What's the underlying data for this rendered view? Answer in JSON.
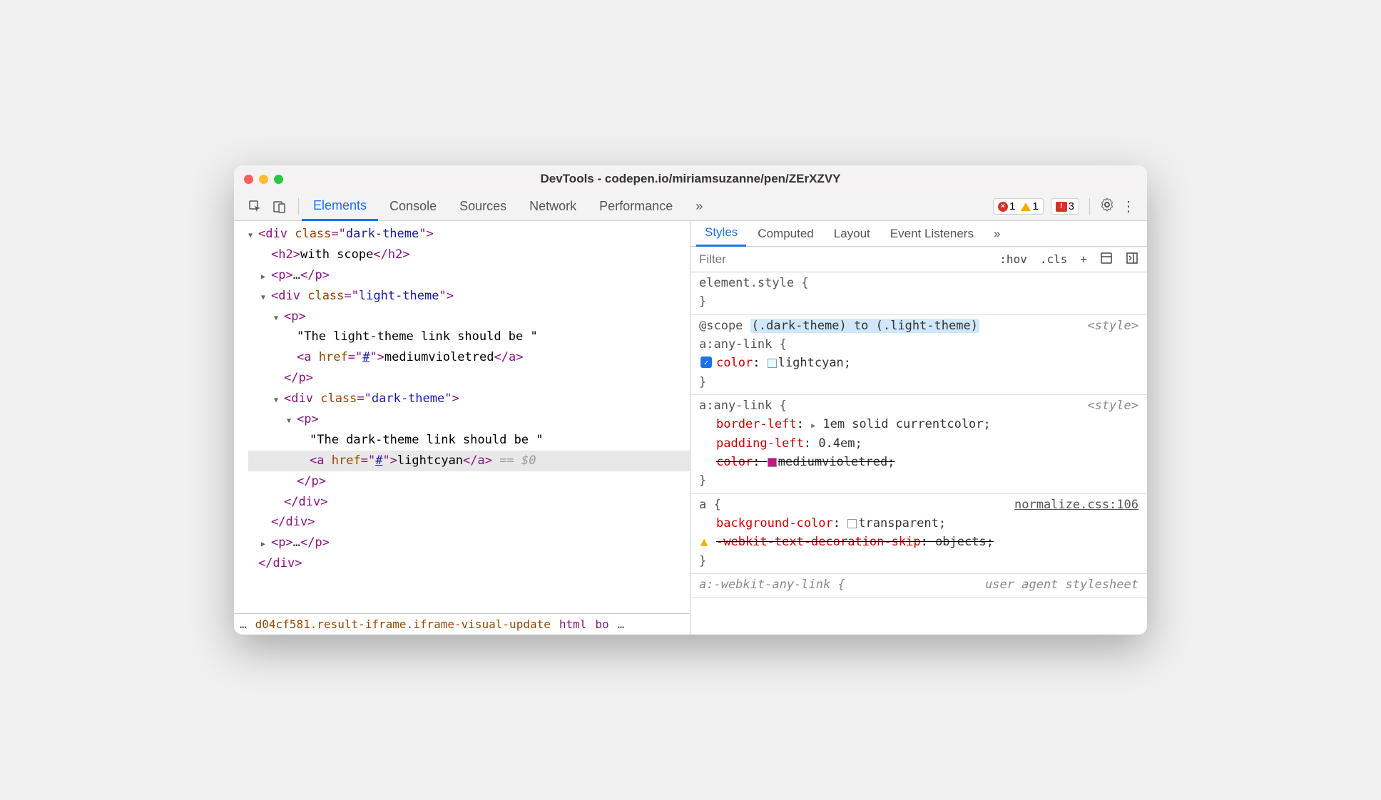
{
  "title": "DevTools - codepen.io/miriamsuzanne/pen/ZErXZVY",
  "tabs": [
    "Elements",
    "Console",
    "Sources",
    "Network",
    "Performance"
  ],
  "tabs_more": "»",
  "badges": {
    "errors": "1",
    "warnings": "1",
    "messages": "3"
  },
  "dom": {
    "l1": {
      "tag": "div",
      "attr": "class",
      "val": "dark-theme"
    },
    "l2": {
      "tag": "h2",
      "text": "with scope"
    },
    "l3": {
      "tag": "p",
      "ell": "…"
    },
    "l4": {
      "tag": "div",
      "attr": "class",
      "val": "light-theme"
    },
    "l5": {
      "tag": "p"
    },
    "l6": {
      "text": "\"The light-theme link should be \""
    },
    "l7": {
      "tag": "a",
      "attr": "href",
      "val": "#",
      "text": "mediumvioletred"
    },
    "l8": {
      "close": "p"
    },
    "l9": {
      "tag": "div",
      "attr": "class",
      "val": "dark-theme"
    },
    "l10": {
      "tag": "p"
    },
    "l11": {
      "text": "\"The dark-theme link should be \""
    },
    "l12": {
      "tag": "a",
      "attr": "href",
      "val": "#",
      "text": "lightcyan",
      "marker": "== $0"
    },
    "l13": {
      "close": "p"
    },
    "l14": {
      "close": "div"
    },
    "l15": {
      "close": "div"
    },
    "l16": {
      "tag": "p",
      "ell": "…"
    },
    "l17": {
      "close": "div"
    }
  },
  "breadcrumbs": {
    "dots": "…",
    "i1": "d04cf581.result-iframe.iframe-visual-update",
    "i2": "html",
    "i3": "bo",
    "trail": "…"
  },
  "sub_tabs": [
    "Styles",
    "Computed",
    "Layout",
    "Event Listeners"
  ],
  "sub_more": "»",
  "filter_placeholder": "Filter",
  "filter_btns": {
    "hov": ":hov",
    "cls": ".cls",
    "plus": "+"
  },
  "rules": {
    "r0": {
      "sel": "element.style {",
      "close": "}"
    },
    "r1": {
      "scope_pre": "@scope ",
      "scope_hl": "(.dark-theme) to (.light-theme)",
      "sel": "a:any-link {",
      "src": "<style>",
      "p1_name": "color",
      "p1_val": "lightcyan;",
      "close": "}"
    },
    "r2": {
      "sel": "a:any-link {",
      "src": "<style>",
      "p1_name": "border-left",
      "p1_val": "1em solid currentcolor;",
      "p2_name": "padding-left",
      "p2_val": "0.4em;",
      "p3_name": "color",
      "p3_val": "mediumvioletred;",
      "close": "}"
    },
    "r3": {
      "sel": "a {",
      "src": "normalize.css:106",
      "p1_name": "background-color",
      "p1_val": "transparent;",
      "p2_name": "-webkit-text-decoration-skip",
      "p2_val": "objects;",
      "close": "}"
    },
    "r4": {
      "sel": "a:-webkit-any-link {",
      "src": "user agent stylesheet"
    }
  }
}
